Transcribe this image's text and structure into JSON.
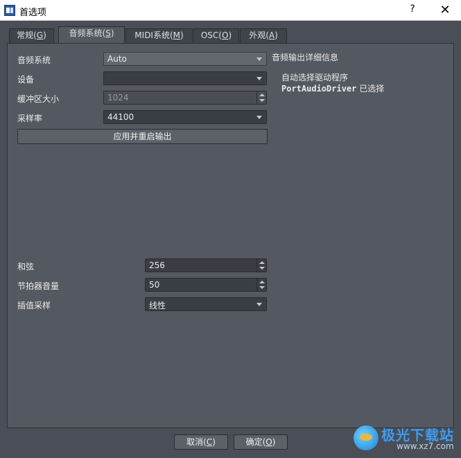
{
  "window": {
    "title": "首选项",
    "help": "?",
    "close": "✕"
  },
  "tabs": [
    {
      "pre": "常规(",
      "key": "G",
      "post": ")"
    },
    {
      "pre": "音频系统(",
      "key": "S",
      "post": ")"
    },
    {
      "pre": "MIDI系统(",
      "key": "M",
      "post": ")"
    },
    {
      "pre": "OSC(",
      "key": "O",
      "post": ")"
    },
    {
      "pre": "外观(",
      "key": "A",
      "post": ")"
    }
  ],
  "audio": {
    "system_label": "音频系统",
    "system_value": "Auto",
    "device_label": "设备",
    "device_value": "",
    "buffer_label": "缓冲区大小",
    "buffer_value": "1024",
    "rate_label": "采样率",
    "rate_value": "44100",
    "apply_button": "应用并重启输出"
  },
  "info": {
    "title": "音频输出详细信息",
    "line1": "自动选择驱动程序",
    "driver": "PortAudioDriver",
    "selected": " 已选择"
  },
  "settings": {
    "polyphony_label": "和弦",
    "polyphony_value": "256",
    "metronome_label": "节拍器音量",
    "metronome_value": "50",
    "interp_label": "插值采样",
    "interp_value": "线性"
  },
  "footer": {
    "cancel_pre": "取消(",
    "cancel_key": "C",
    "cancel_post": ")",
    "ok_pre": "确定(",
    "ok_key": "O",
    "ok_post": ")"
  },
  "watermark": {
    "name": "极光下载站",
    "url": "www.xz7.com"
  }
}
